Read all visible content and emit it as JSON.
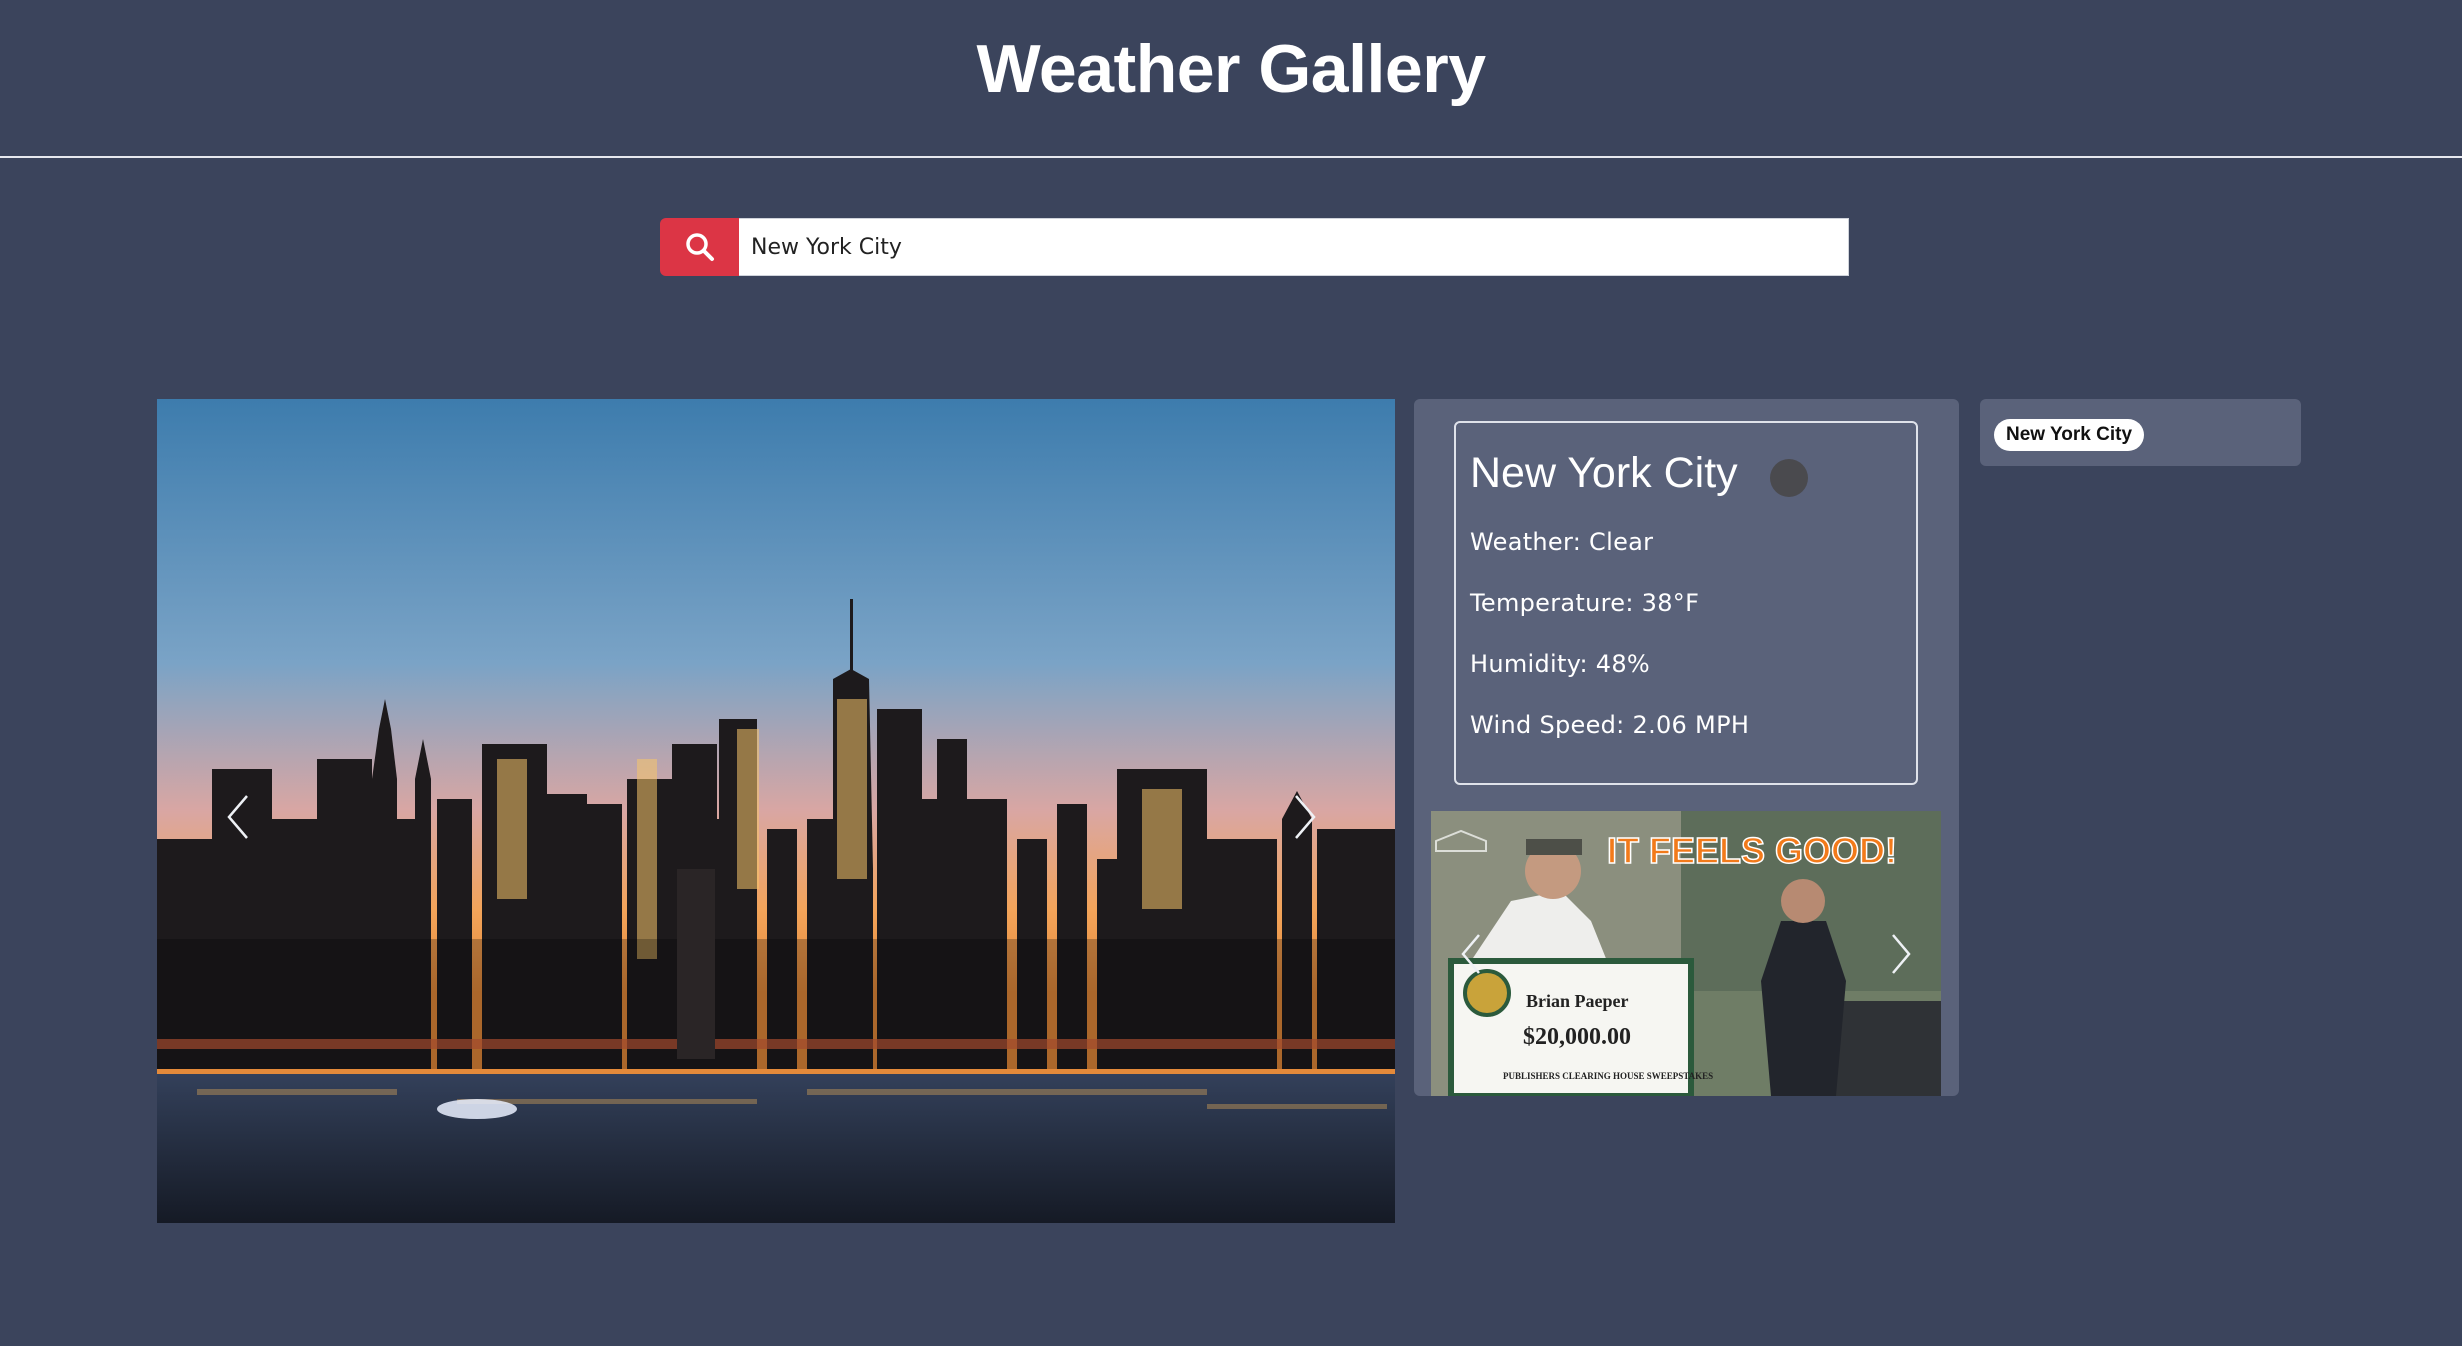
{
  "header": {
    "title": "Weather Gallery"
  },
  "search": {
    "value": "New York City",
    "button_icon": "search-icon"
  },
  "gallery": {
    "prev_icon": "chevron-left-icon",
    "next_icon": "chevron-right-icon"
  },
  "weather": {
    "city": "New York City",
    "status_icon": "weather-status-dot",
    "lines": [
      "Weather: Clear",
      "Temperature: 38°F",
      "Humidity: 48%",
      "Wind Speed: 2.06 MPH"
    ]
  },
  "ad": {
    "headline": "IT FEELS GOOD!",
    "check_name": "Brian Paeper",
    "check_amount": "$20,000.00",
    "check_footer": "PUBLISHERS CLEARING HOUSE SWEEPSTAKES"
  },
  "history": {
    "items": [
      "New York City"
    ]
  },
  "colors": {
    "background": "#3b445c",
    "panel": "#5a627a",
    "accent": "#dc3545"
  }
}
